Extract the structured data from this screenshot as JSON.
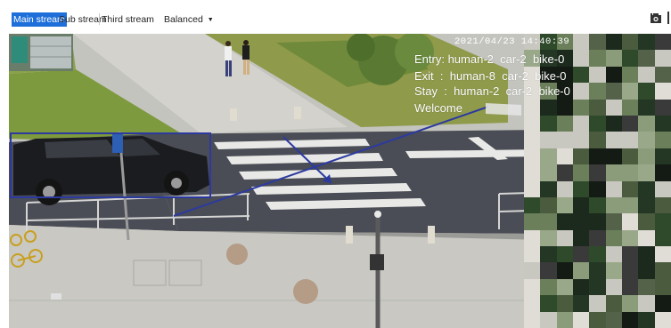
{
  "toolbar": {
    "tabs": [
      {
        "label": "Main stream",
        "active": true
      },
      {
        "label": "Sub stream",
        "active": false
      },
      {
        "label": "Third stream",
        "active": false
      }
    ],
    "quality_label": "Balanced",
    "quality_icon": "chevron-down-icon",
    "right_icon": "snapshot-icon",
    "accent_color": "#1e6fd9"
  },
  "video": {
    "timestamp": "2021/04/23 14:40:39",
    "counter": {
      "entry": "Entry: human-2  car-2  bike-0",
      "exit": "Exit  :  human-8  car-2  bike-0",
      "stay": "Stay  :  human-2  car-2  bike-0",
      "welcome": "Welcome"
    },
    "detection_box_color": "#2c3aa0",
    "counting_line_color": "#2c3aa0"
  }
}
